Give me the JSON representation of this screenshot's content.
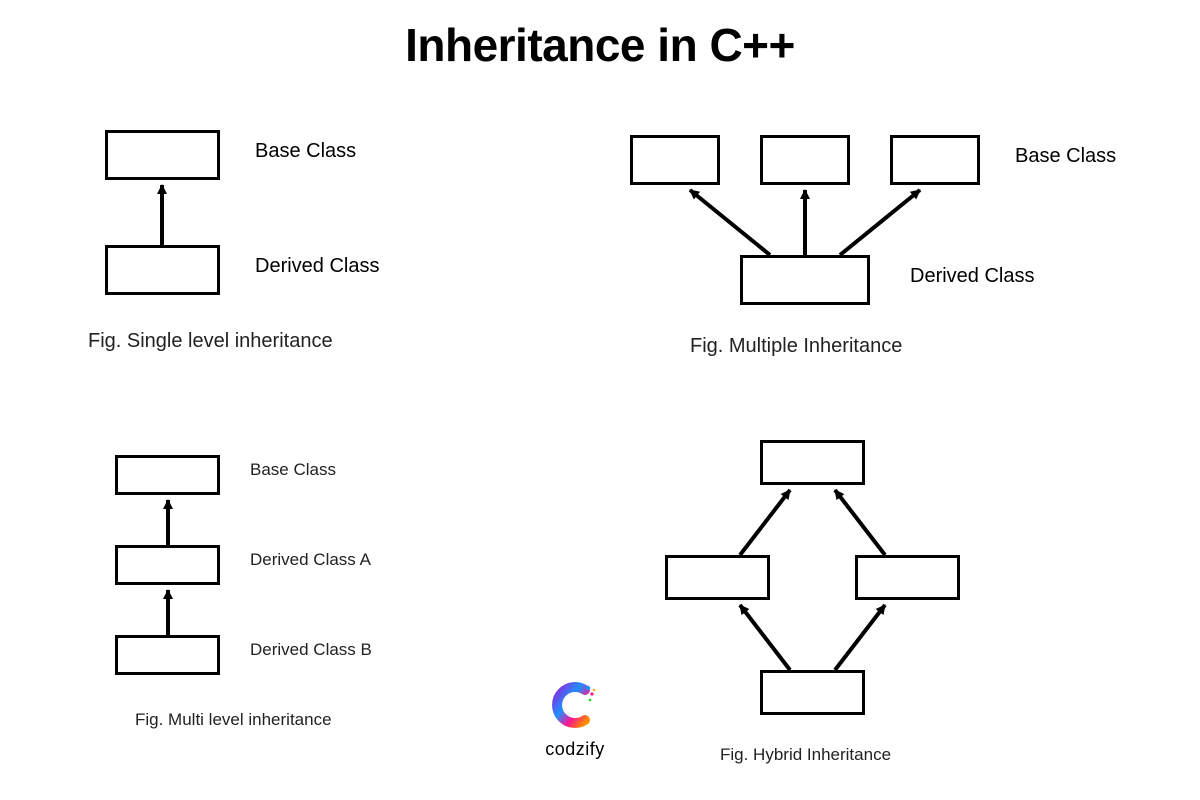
{
  "title": "Inheritance in C++",
  "diagrams": {
    "single": {
      "base_label": "Base Class",
      "derived_label": "Derived Class",
      "caption": "Fig. Single level inheritance"
    },
    "multiple": {
      "base_label": "Base Class",
      "derived_label": "Derived Class",
      "caption": "Fig. Multiple Inheritance"
    },
    "multilevel": {
      "base_label": "Base Class",
      "derived_a_label": "Derived Class A",
      "derived_b_label": "Derived Class B",
      "caption": "Fig. Multi level inheritance"
    },
    "hybrid": {
      "caption": "Fig. Hybrid Inheritance"
    }
  },
  "brand": {
    "name": "codzify"
  }
}
